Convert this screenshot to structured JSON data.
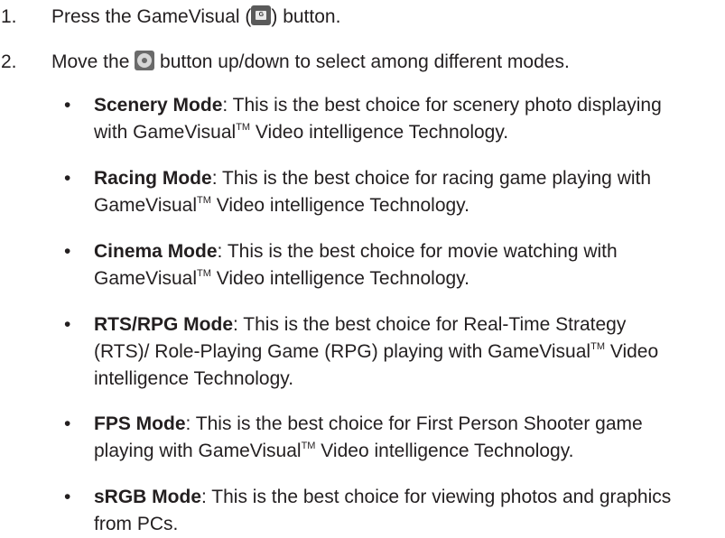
{
  "steps": [
    {
      "number": "1.",
      "text_before": "Press the GameVisual (",
      "icon": "gamevisual-button-icon",
      "text_after": ") button."
    },
    {
      "number": "2.",
      "text_before": "Move the ",
      "icon": "five-way-joystick-icon",
      "text_after": " button up/down to select among different modes."
    }
  ],
  "modes": [
    {
      "term": "Scenery Mode",
      "line1": ": This is the best choice for scenery photo displaying",
      "line2_pre": "with GameVisual",
      "tm": "TM",
      "line2_post": " Video intelligence Technology."
    },
    {
      "term": "Racing Mode",
      "line1": ": This is the best choice for racing game playing with",
      "line2_pre": "GameVisual",
      "tm": "TM",
      "line2_post": " Video intelligence Technology."
    },
    {
      "term": "Cinema Mode",
      "line1": ": This is the best choice for movie watching with",
      "line2_pre": "GameVisual",
      "tm": "TM",
      "line2_post": " Video intelligence Technology."
    },
    {
      "term": "RTS/RPG Mode",
      "line1": ": This is the best choice for Real-Time Strategy",
      "line2_pre": "(RTS)/ Role-Playing Game (RPG) playing with GameVisual",
      "tm": "TM",
      "line2_post": " Video",
      "line3": "intelligence Technology."
    },
    {
      "term": "FPS Mode",
      "line1": ": This is the best choice for First Person Shooter game",
      "line2_pre": "playing with GameVisual",
      "tm": "TM",
      "line2_post": " Video intelligence Technology."
    },
    {
      "term": "sRGB Mode",
      "line1": ": This is the best choice for viewing photos and graphics",
      "line2_pre": "from PCs.",
      "tm": "",
      "line2_post": ""
    }
  ],
  "bullet_glyph": "•"
}
